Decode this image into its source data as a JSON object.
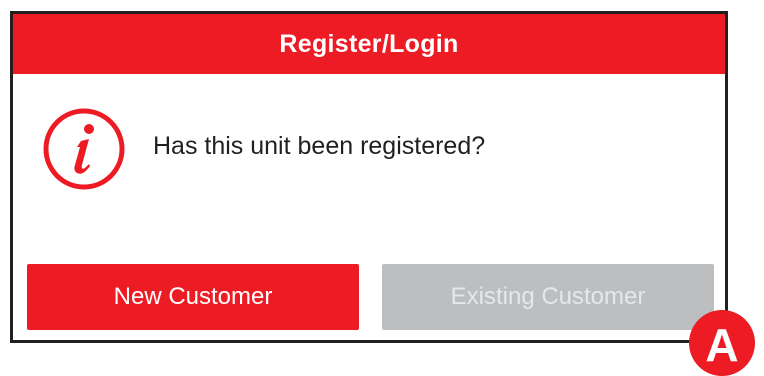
{
  "dialog": {
    "title": "Register/Login",
    "message": "Has this unit been registered?",
    "icon": "info-icon",
    "buttons": {
      "new_customer": "New Customer",
      "existing_customer": "Existing Customer"
    }
  },
  "callout": {
    "label": "A"
  },
  "colors": {
    "accent": "#ed1c24",
    "disabled": "#bcbec0",
    "border": "#231f20"
  }
}
